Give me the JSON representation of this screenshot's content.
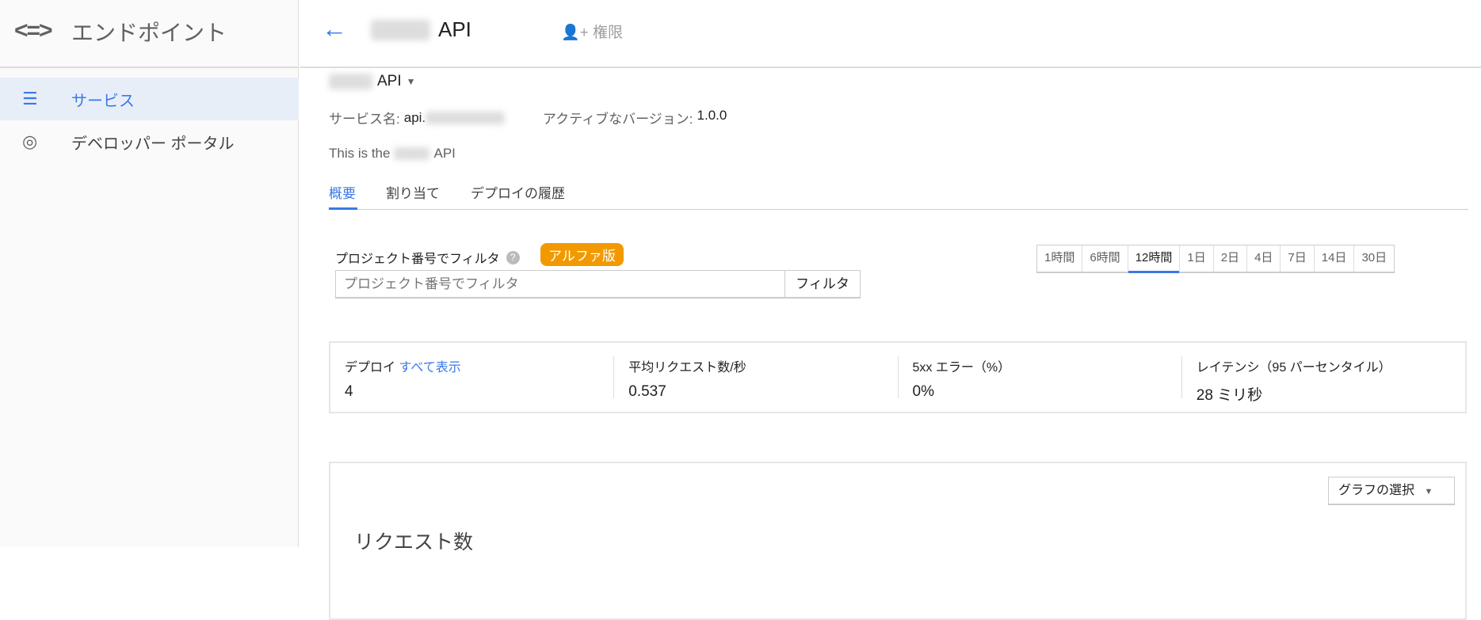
{
  "sidebar": {
    "logo": "<=>",
    "title": "エンドポイント",
    "items": [
      {
        "label": "サービス",
        "icon": "list-icon"
      },
      {
        "label": "デベロッパー ポータル",
        "icon": "portal-icon"
      }
    ]
  },
  "header": {
    "back": "←",
    "title": "API",
    "permissions": "権限"
  },
  "service": {
    "selector": "API",
    "name_label": "サービス名:",
    "name_value": "api.",
    "version_label": "アクティブなバージョン:",
    "version_value": "1.0.0",
    "desc_prefix": "This is the",
    "desc_suffix": "API"
  },
  "tabs": [
    "概要",
    "割り当て",
    "デプロイの履歴"
  ],
  "filter": {
    "label": "プロジェクト番号でフィルタ",
    "badge": "アルファ版",
    "placeholder": "プロジェクト番号でフィルタ",
    "button": "フィルタ"
  },
  "time_ranges": [
    "1時間",
    "6時間",
    "12時間",
    "1日",
    "2日",
    "4日",
    "7日",
    "14日",
    "30日"
  ],
  "selected_time_range": "12時間",
  "stats": [
    {
      "label": "デプロイ",
      "link": "すべて表示",
      "value": "4"
    },
    {
      "label": "平均リクエスト数/秒",
      "value": "0.537"
    },
    {
      "label": "5xx エラー（%）",
      "value": "0%"
    },
    {
      "label": "レイテンシ（95 パーセンタイル）",
      "value": "28 ミリ秒"
    }
  ],
  "chart": {
    "select": "グラフの選択",
    "title": "リクエスト数"
  }
}
